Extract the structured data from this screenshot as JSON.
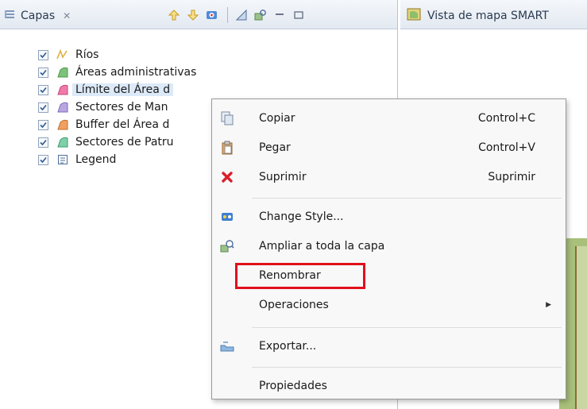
{
  "layers_panel": {
    "tab_label": "Capas",
    "tab_close": "✕",
    "toolbar_icons": [
      "arrow-up-icon",
      "arrow-down-icon",
      "layer-add-icon",
      "ruler-icon",
      "zoom-layer-icon",
      "minimize-icon",
      "maximize-icon"
    ],
    "layers": [
      {
        "label": "Ríos",
        "checked": true,
        "icon": "river-line-icon"
      },
      {
        "label": "Áreas administrativas",
        "checked": true,
        "icon": "polygon-green-icon"
      },
      {
        "label": "Límite del Área d",
        "checked": true,
        "icon": "polygon-pink-icon",
        "selected": true
      },
      {
        "label": "Sectores de Man",
        "checked": true,
        "icon": "polygon-purple-icon"
      },
      {
        "label": "Buffer del Área d",
        "checked": true,
        "icon": "polygon-orange-icon"
      },
      {
        "label": "Sectores de Patru",
        "checked": true,
        "icon": "polygon-teal-icon"
      },
      {
        "label": "Legend",
        "checked": true,
        "icon": "legend-icon"
      }
    ]
  },
  "map_panel": {
    "tab_label": "Vista de mapa SMART"
  },
  "context_menu": {
    "items": [
      {
        "label": "Copiar",
        "shortcut": "Control+C",
        "icon": "copy-icon"
      },
      {
        "label": "Pegar",
        "shortcut": "Control+V",
        "icon": "paste-icon"
      },
      {
        "label": "Suprimir",
        "shortcut": "Suprimir",
        "icon": "delete-icon"
      },
      {
        "label": "Change Style...",
        "shortcut": "",
        "icon": "style-icon"
      },
      {
        "label": "Ampliar a toda la capa",
        "shortcut": "",
        "icon": "zoom-to-layer-icon"
      },
      {
        "label": "Renombrar",
        "shortcut": "",
        "icon": ""
      },
      {
        "label": "Operaciones",
        "shortcut": "",
        "icon": "",
        "submenu": true
      },
      {
        "label": "Exportar...",
        "shortcut": "",
        "icon": "export-icon"
      },
      {
        "label": "Propiedades",
        "shortcut": "",
        "icon": ""
      }
    ],
    "highlighted_item": "Renombrar",
    "highlight_color": "#e0101a"
  }
}
